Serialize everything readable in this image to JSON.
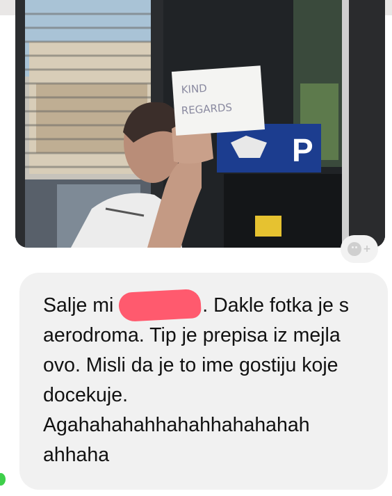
{
  "photo": {
    "sign_text_line1": "KIND",
    "sign_text_line2": "REGARDS",
    "parking_sign": "P"
  },
  "reaction": {
    "icon": "add-reaction-icon",
    "plus": "+"
  },
  "message": {
    "text_before_redaction": "Salje mi ",
    "text_after_redaction": ". Dakle fotka je s aerodroma. Tip je prepisa iz mejla ovo. Misli da je to ime gostiju koje docekuje. Agahahahahhahahhahahahah ahhaha",
    "redaction_color": "#ff5a6e"
  },
  "status": {
    "online_color": "#3ecf4a"
  }
}
